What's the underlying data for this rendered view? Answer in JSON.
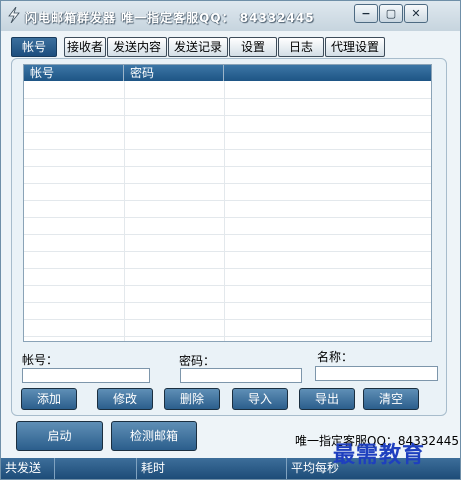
{
  "window": {
    "title": "闪电邮箱群发器  唯一指定客服QQ：  84332445",
    "controls": {
      "minimize": "−",
      "restore": "▢",
      "close": "✕"
    }
  },
  "tabs": [
    {
      "label": "帐号",
      "active": true
    },
    {
      "label": "接收者",
      "active": false
    },
    {
      "label": "发送内容",
      "active": false
    },
    {
      "label": "发送记录",
      "active": false
    },
    {
      "label": "设置",
      "active": false
    },
    {
      "label": "日志",
      "active": false
    },
    {
      "label": "代理设置",
      "active": false
    }
  ],
  "account_table": {
    "columns": [
      "帐号",
      "密码"
    ],
    "rows": []
  },
  "form": {
    "account_label": "帐号：",
    "account_value": "",
    "password_label": "密码：",
    "password_value": "",
    "name_label": "名称：",
    "name_value": ""
  },
  "actions": {
    "add": "添加",
    "edit": "修改",
    "delete": "删除",
    "import": "导入",
    "export": "导出",
    "clear": "清空"
  },
  "main_actions": {
    "start": "启动",
    "check_mailbox": "检测邮箱"
  },
  "footer_note": "唯一指定客服QQ：84332445",
  "status_bar": {
    "total_sent": "共发送",
    "elapsed": "耗时",
    "avg_per_second": "平均每秒"
  },
  "watermark": "最需教育",
  "colors": {
    "accent": "#2b5e8c",
    "tab_active": "#1d4e7e",
    "panel_bg": "#eaf2f7",
    "watermark": "#1e3fbf"
  }
}
